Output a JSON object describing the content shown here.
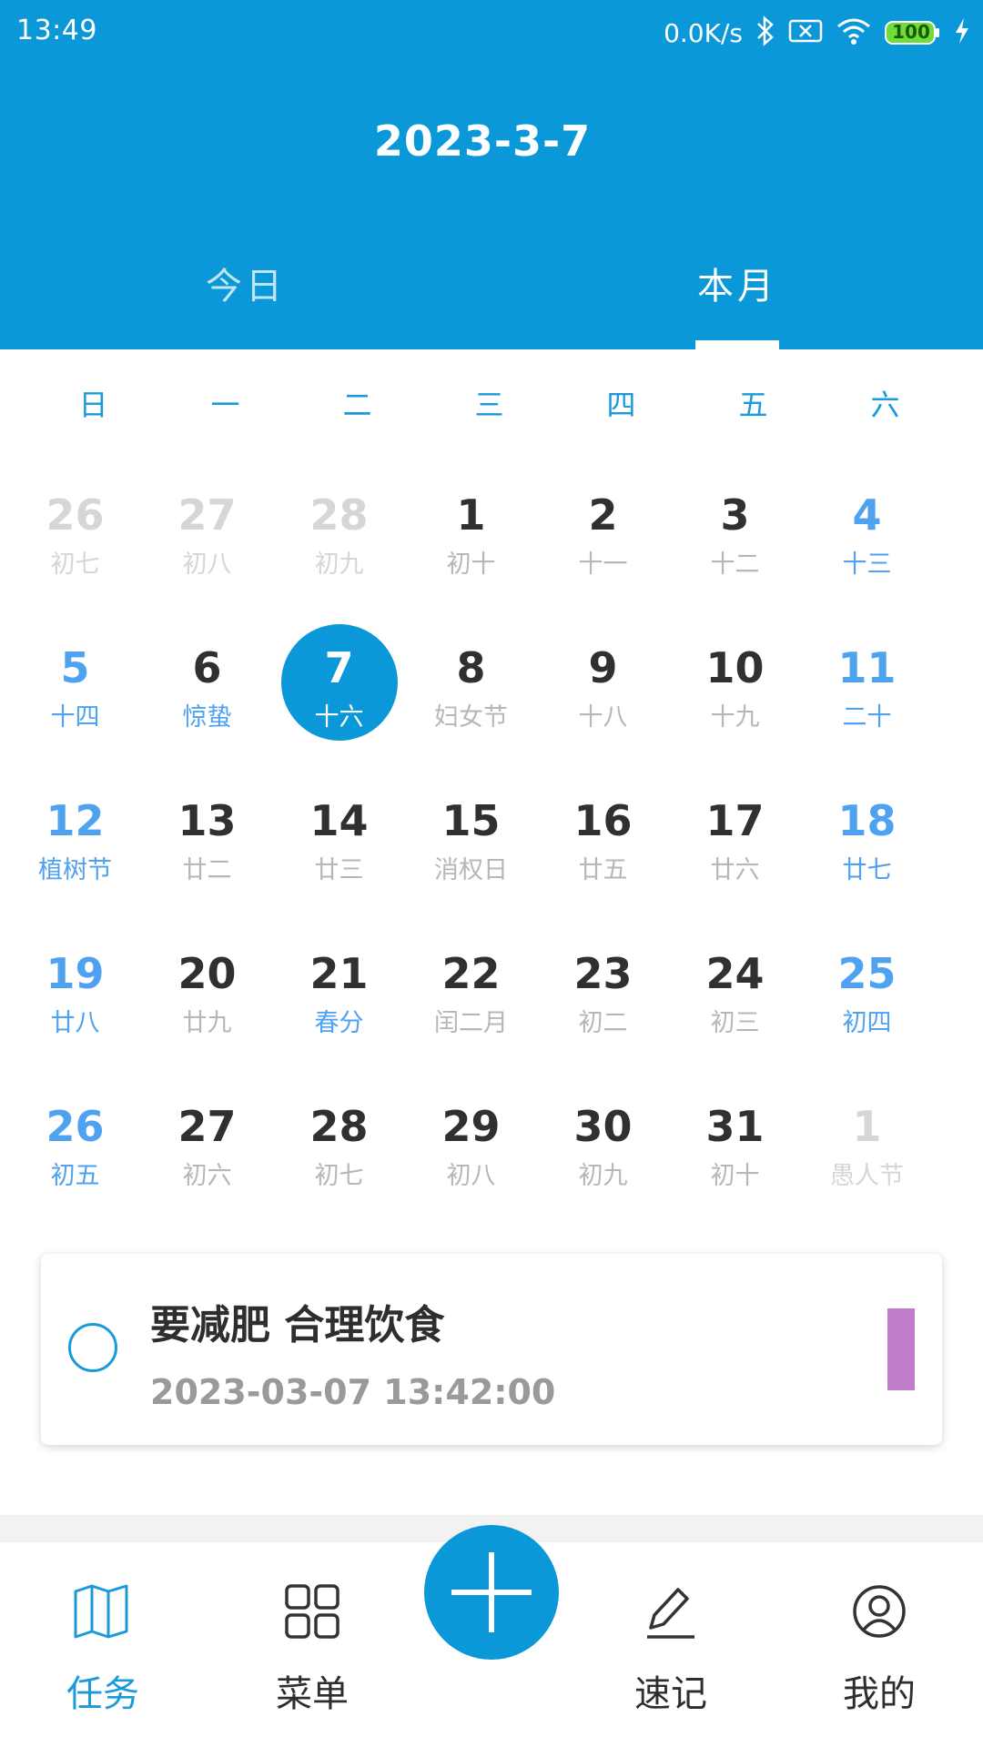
{
  "status_bar": {
    "time": "13:49",
    "net_speed": "0.0K/s",
    "battery": "100"
  },
  "header": {
    "title": "2023-3-7",
    "tabs": [
      {
        "label": "今日",
        "active": false
      },
      {
        "label": "本月",
        "active": true
      }
    ]
  },
  "calendar": {
    "weekdays": [
      "日",
      "一",
      "二",
      "三",
      "四",
      "五",
      "六"
    ],
    "rows": [
      [
        {
          "day": "26",
          "lunar": "初七",
          "type": "other"
        },
        {
          "day": "27",
          "lunar": "初八",
          "type": "other"
        },
        {
          "day": "28",
          "lunar": "初九",
          "type": "other"
        },
        {
          "day": "1",
          "lunar": "初十",
          "type": "normal"
        },
        {
          "day": "2",
          "lunar": "十一",
          "type": "normal"
        },
        {
          "day": "3",
          "lunar": "十二",
          "type": "normal"
        },
        {
          "day": "4",
          "lunar": "十三",
          "type": "weekend"
        }
      ],
      [
        {
          "day": "5",
          "lunar": "十四",
          "type": "weekend"
        },
        {
          "day": "6",
          "lunar": "惊蛰",
          "type": "festival"
        },
        {
          "day": "7",
          "lunar": "十六",
          "type": "selected"
        },
        {
          "day": "8",
          "lunar": "妇女节",
          "type": "normal"
        },
        {
          "day": "9",
          "lunar": "十八",
          "type": "normal"
        },
        {
          "day": "10",
          "lunar": "十九",
          "type": "normal"
        },
        {
          "day": "11",
          "lunar": "二十",
          "type": "weekend"
        }
      ],
      [
        {
          "day": "12",
          "lunar": "植树节",
          "type": "weekend"
        },
        {
          "day": "13",
          "lunar": "廿二",
          "type": "normal"
        },
        {
          "day": "14",
          "lunar": "廿三",
          "type": "normal"
        },
        {
          "day": "15",
          "lunar": "消权日",
          "type": "normal"
        },
        {
          "day": "16",
          "lunar": "廿五",
          "type": "normal"
        },
        {
          "day": "17",
          "lunar": "廿六",
          "type": "normal"
        },
        {
          "day": "18",
          "lunar": "廿七",
          "type": "weekend"
        }
      ],
      [
        {
          "day": "19",
          "lunar": "廿八",
          "type": "weekend"
        },
        {
          "day": "20",
          "lunar": "廿九",
          "type": "normal"
        },
        {
          "day": "21",
          "lunar": "春分",
          "type": "festival"
        },
        {
          "day": "22",
          "lunar": "闰二月",
          "type": "normal"
        },
        {
          "day": "23",
          "lunar": "初二",
          "type": "normal"
        },
        {
          "day": "24",
          "lunar": "初三",
          "type": "normal"
        },
        {
          "day": "25",
          "lunar": "初四",
          "type": "weekend"
        }
      ],
      [
        {
          "day": "26",
          "lunar": "初五",
          "type": "weekend"
        },
        {
          "day": "27",
          "lunar": "初六",
          "type": "normal"
        },
        {
          "day": "28",
          "lunar": "初七",
          "type": "normal"
        },
        {
          "day": "29",
          "lunar": "初八",
          "type": "normal"
        },
        {
          "day": "30",
          "lunar": "初九",
          "type": "normal"
        },
        {
          "day": "31",
          "lunar": "初十",
          "type": "normal"
        },
        {
          "day": "1",
          "lunar": "愚人节",
          "type": "other"
        }
      ]
    ]
  },
  "task": {
    "title": "要减肥 合理饮食",
    "datetime": "2023-03-07 13:42:00",
    "tag_color": "#c07cc8"
  },
  "nav": {
    "items": [
      {
        "label": "任务",
        "icon": "map-icon",
        "active": true
      },
      {
        "label": "菜单",
        "icon": "grid-icon",
        "active": false
      },
      {
        "label": "速记",
        "icon": "pen-icon",
        "active": false
      },
      {
        "label": "我的",
        "icon": "user-icon",
        "active": false
      }
    ],
    "fab_icon": "plus-icon"
  },
  "colors": {
    "primary": "#0b98d8",
    "weekend": "#4fa2f0",
    "muted": "#b7b7b7"
  }
}
